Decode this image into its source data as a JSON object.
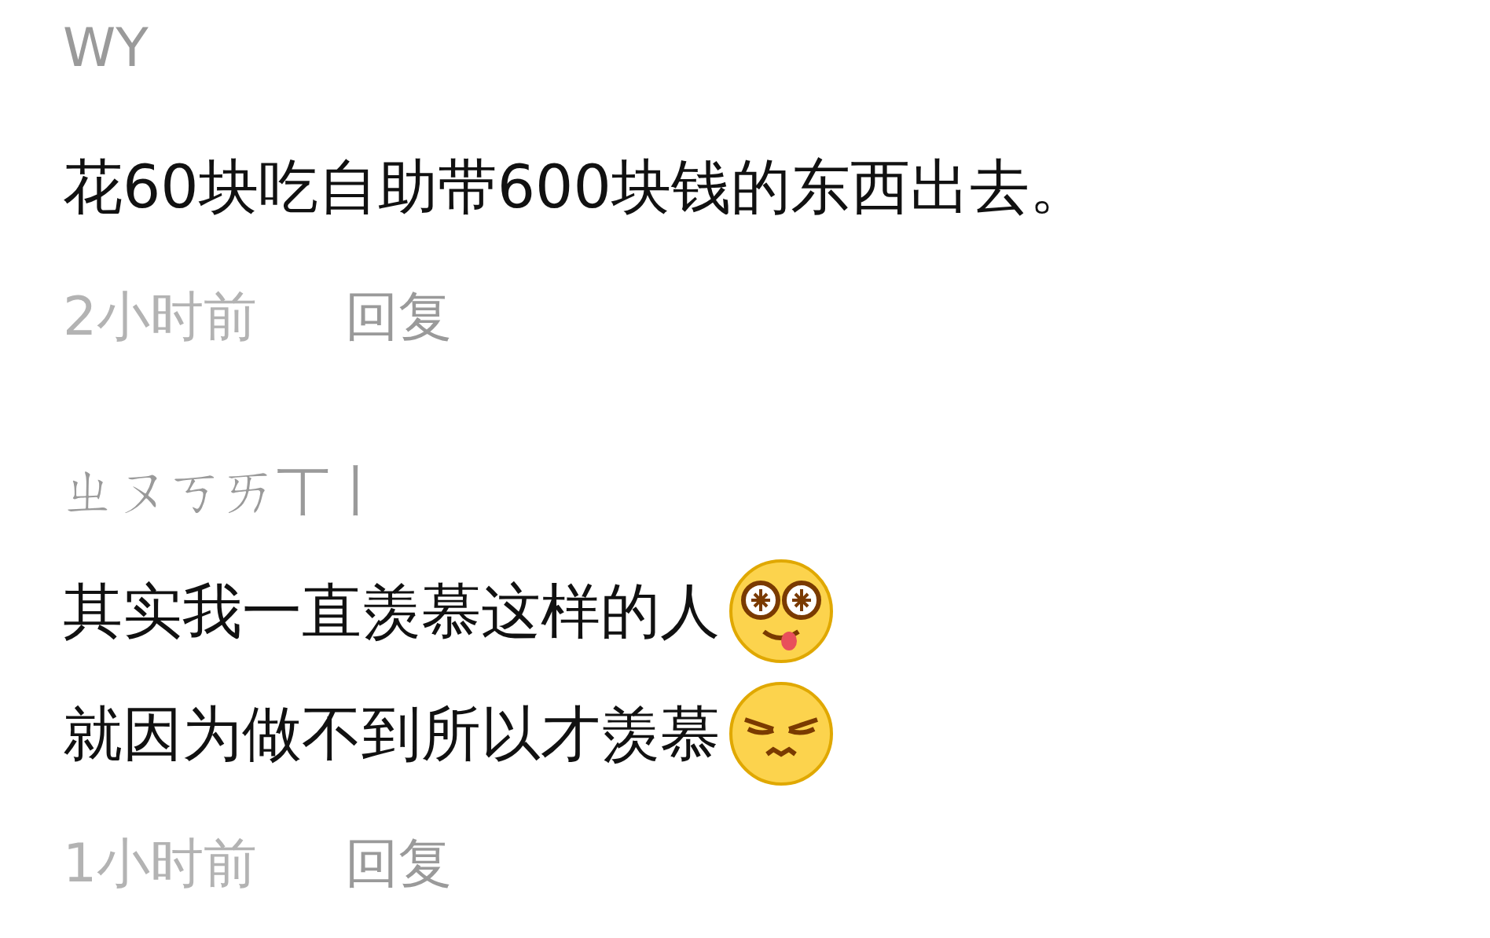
{
  "comments": [
    {
      "username": "WY",
      "lines": [
        {
          "text": "花60块吃自助带600块钱的东西出去。"
        }
      ],
      "time": "2小时前",
      "reply": "回复"
    },
    {
      "username": "ㄓㄡㄎㄞ丅丨",
      "lines": [
        {
          "text": "其实我一直羡慕这样的人",
          "kind": "starry"
        },
        {
          "text": "就因为做不到所以才羡慕",
          "kind": "squint"
        }
      ],
      "time": "1小时前",
      "reply": "回复"
    }
  ]
}
